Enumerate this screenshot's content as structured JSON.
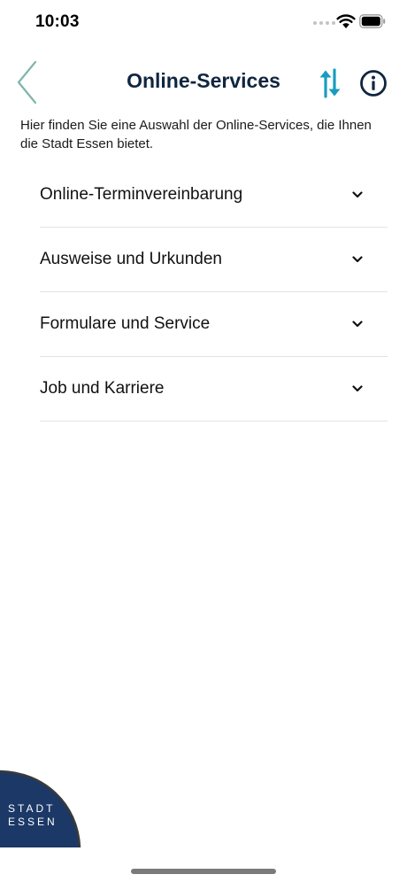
{
  "status": {
    "time": "10:03"
  },
  "header": {
    "title": "Online-Services"
  },
  "intro": "Hier finden Sie eine Auswahl der Online-Services, die Ihnen die Stadt Essen bietet.",
  "sections": [
    {
      "label": "Online-Terminvereinbarung"
    },
    {
      "label": "Ausweise und Urkunden"
    },
    {
      "label": "Formulare und Service"
    },
    {
      "label": "Job und Karriere"
    }
  ],
  "logo": {
    "line1": "STADT",
    "line2": "ESSEN"
  },
  "icons": {
    "back": "chevron-left-icon",
    "sort": "sort-arrows-icon",
    "info": "info-icon",
    "chevron": "chevron-down-icon",
    "wifi": "wifi-icon",
    "battery": "battery-icon"
  },
  "colors": {
    "title": "#10263f",
    "accent": "#1a9cc0",
    "back": "#7fb5ad",
    "logo": "#1b3866"
  }
}
